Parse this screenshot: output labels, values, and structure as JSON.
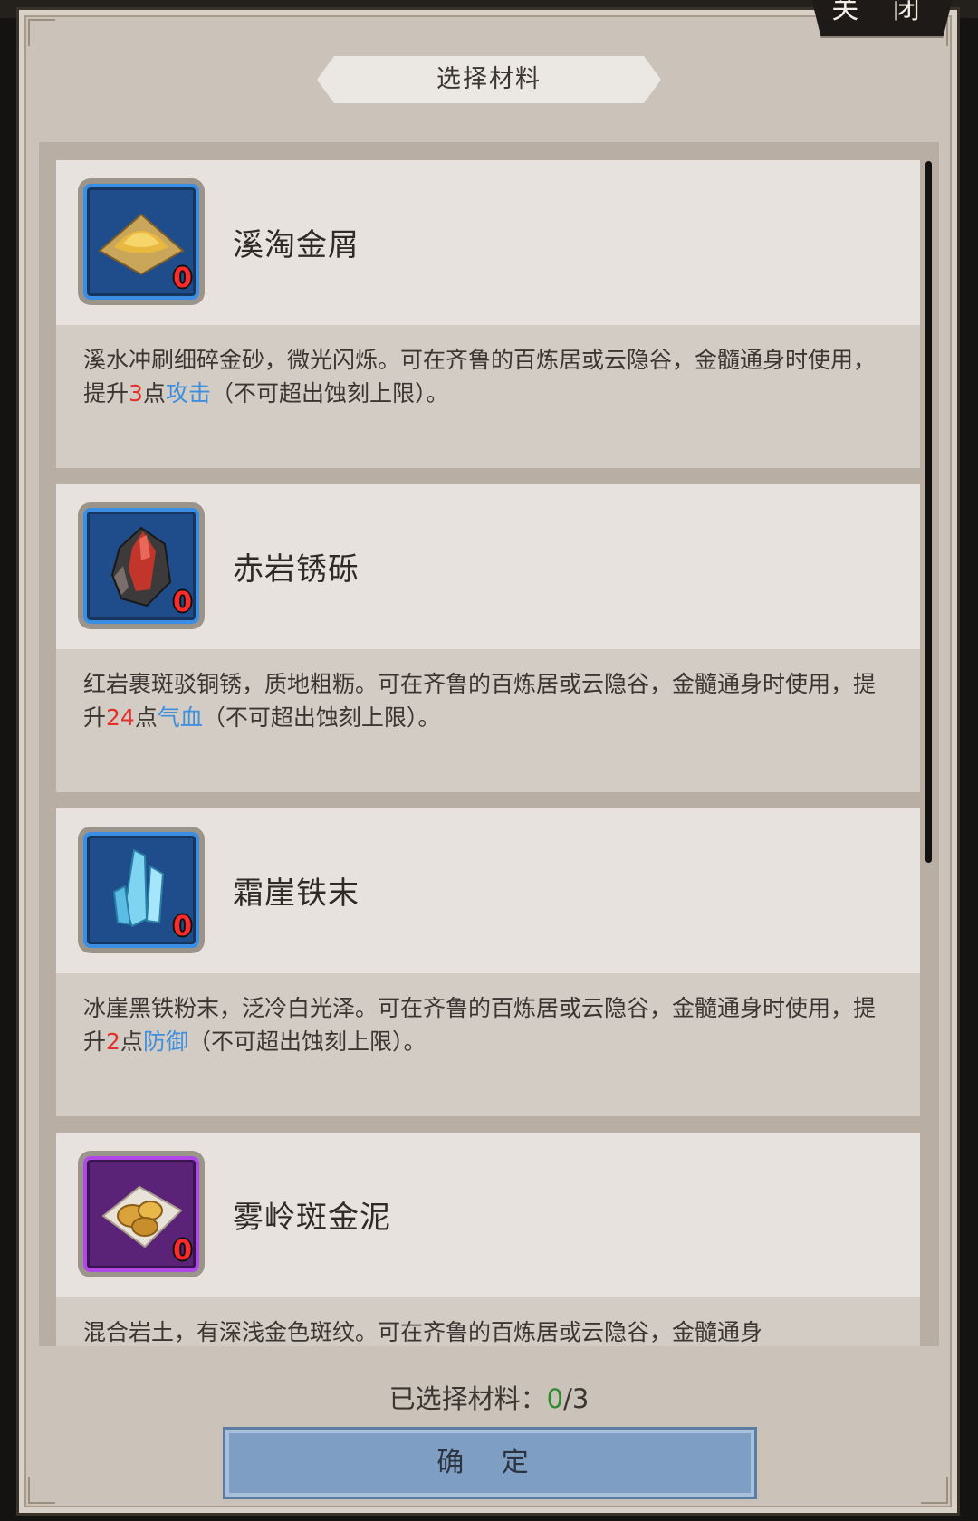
{
  "background_hint": "",
  "close_label": "关 闭",
  "title": "选择材料",
  "materials": [
    {
      "name": "溪淘金屑",
      "count": "0",
      "frame": "blue",
      "icon": "gold-dust-icon",
      "desc_pre": "溪水冲刷细碎金砂，微光闪烁。可在齐鲁的百炼居或云隐谷，金髓通身时使用，提升",
      "amount": "3",
      "unit": "点",
      "stat": "攻击",
      "desc_post": "（不可超出蚀刻上限）。"
    },
    {
      "name": "赤岩锈砾",
      "count": "0",
      "frame": "blue",
      "icon": "red-ore-icon",
      "desc_pre": "红岩裹斑驳铜锈，质地粗粝。可在齐鲁的百炼居或云隐谷，金髓通身时使用，提升",
      "amount": "24",
      "unit": "点",
      "stat": "气血",
      "desc_post": "（不可超出蚀刻上限）。"
    },
    {
      "name": "霜崖铁末",
      "count": "0",
      "frame": "blue",
      "icon": "ice-crystal-icon",
      "desc_pre": "冰崖黑铁粉末，泛冷白光泽。可在齐鲁的百炼居或云隐谷，金髓通身时使用，提升",
      "amount": "2",
      "unit": "点",
      "stat": "防御",
      "desc_post": "（不可超出蚀刻上限）。"
    },
    {
      "name": "雾岭斑金泥",
      "count": "0",
      "frame": "purple",
      "icon": "gold-nugget-icon",
      "desc_pre": "混合岩土，有深浅金色斑纹。可在齐鲁的百炼居或云隐谷，金髓通身",
      "amount": "",
      "unit": "",
      "stat": "",
      "desc_post": ""
    }
  ],
  "selected_label": "已选择材料：",
  "selected_current": "0",
  "selected_max": "/3",
  "confirm_label": "确 定"
}
